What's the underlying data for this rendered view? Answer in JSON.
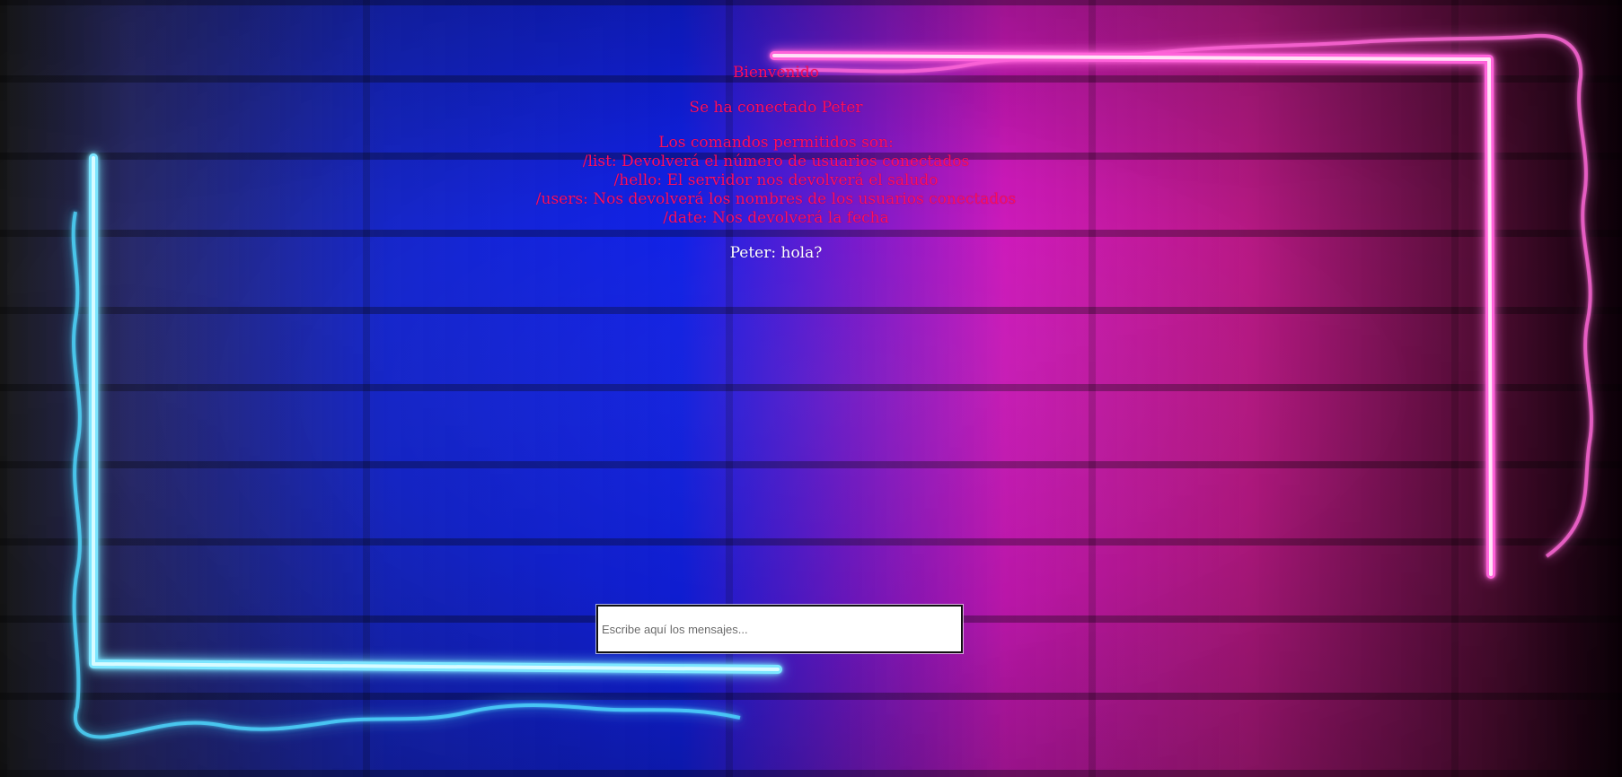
{
  "chat": {
    "messages": [
      {
        "text": "Bienvenido",
        "type": "system"
      },
      {
        "text": "Se ha conectado Peter",
        "type": "system"
      },
      {
        "text": "Los comandos permitidos son:\n/list: Devolverá el número de usuarios conectados\n/hello: El servidor nos devolverá el saludo\n/users: Nos devolverá los nombres de los usuarios conectados\n/date: Nos devolverá la fecha",
        "type": "system"
      },
      {
        "text": "Peter: hola?",
        "type": "user"
      }
    ]
  },
  "composer": {
    "placeholder": "Escribe aquí los mensajes..."
  },
  "colors": {
    "system_text": "#ff0d5f",
    "user_text": "#ffffff",
    "neon_blue": "#38cfff",
    "neon_pink": "#ff38d0"
  }
}
